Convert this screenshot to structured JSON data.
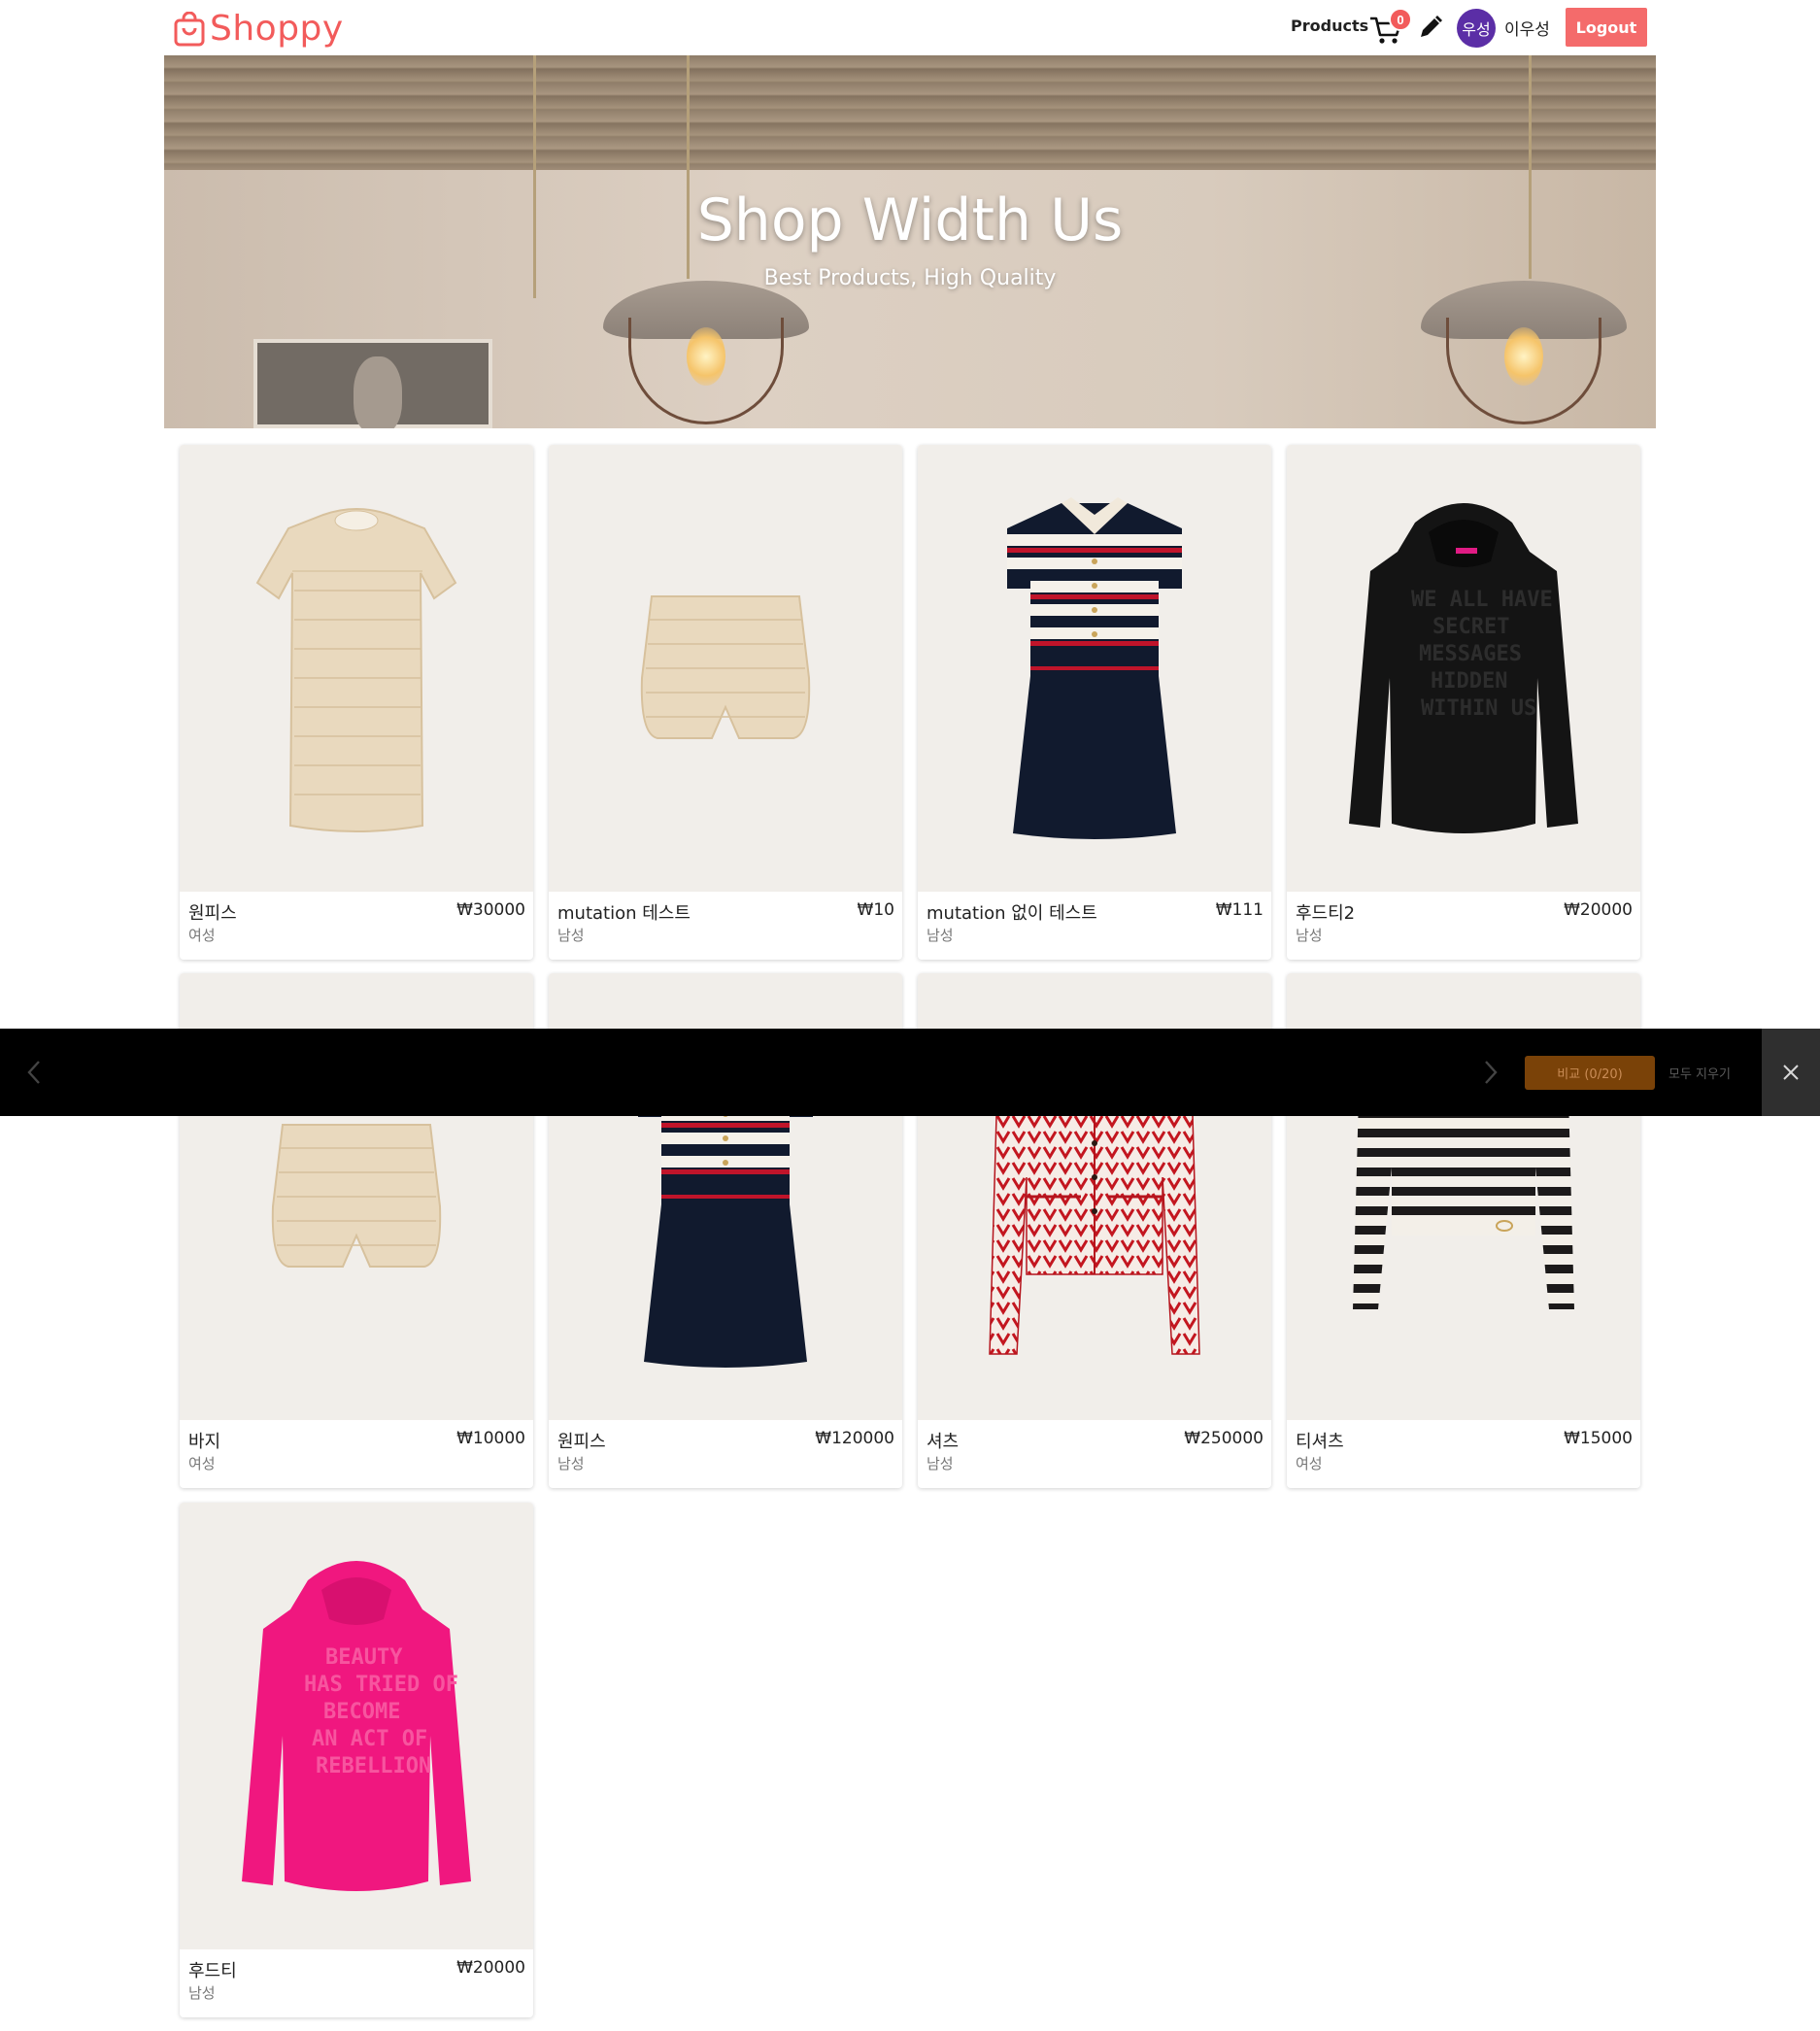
{
  "header": {
    "logo_text": "Shoppy",
    "logo_icon": "shopping-bag-icon",
    "nav_products": "Products",
    "cart_count": "0",
    "cart_icon": "cart-icon",
    "edit_icon": "pencil-icon",
    "avatar_text": "우성",
    "username": "이우성",
    "logout_label": "Logout",
    "brand_color": "#f25b5b"
  },
  "hero": {
    "title": "Shop Width Us",
    "subtitle": "Best Products, High Quality"
  },
  "products": [
    {
      "name": "원피스",
      "price": "₩30000",
      "gender": "여성",
      "image": "beige-tweed-dress"
    },
    {
      "name": "mutation 테스트",
      "price": "₩10",
      "gender": "남성",
      "image": "beige-tweed-shorts"
    },
    {
      "name": "mutation 없이 테스트",
      "price": "₩111",
      "gender": "남성",
      "image": "navy-striped-dress"
    },
    {
      "name": "후드티2",
      "price": "₩20000",
      "gender": "남성",
      "image": "black-hoodie"
    },
    {
      "name": "바지",
      "price": "₩10000",
      "gender": "여성",
      "image": "beige-tweed-shorts"
    },
    {
      "name": "원피스",
      "price": "₩120000",
      "gender": "남성",
      "image": "navy-striped-dress"
    },
    {
      "name": "셔츠",
      "price": "₩250000",
      "gender": "남성",
      "image": "red-pattern-cardigan"
    },
    {
      "name": "티셔츠",
      "price": "₩15000",
      "gender": "여성",
      "image": "striped-sweater"
    },
    {
      "name": "후드티",
      "price": "₩20000",
      "gender": "남성",
      "image": "pink-hoodie"
    }
  ],
  "compare_bar": {
    "compare_label": "비교 (0/20)",
    "clear_label": "모두 지우기",
    "prev_icon": "chevron-left-icon",
    "next_icon": "chevron-right-icon",
    "close_icon": "close-icon"
  }
}
